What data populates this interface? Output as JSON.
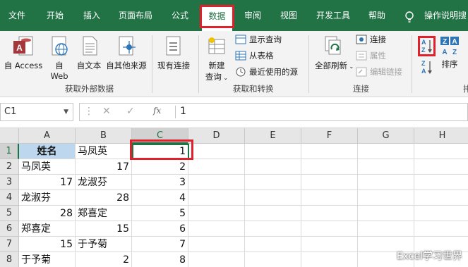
{
  "ribbon_tabs": [
    "文件",
    "开始",
    "插入",
    "页面布局",
    "公式",
    "数据",
    "审阅",
    "视图",
    "开发工具",
    "帮助",
    "操作说明搜"
  ],
  "active_tab": "数据",
  "ribbon": {
    "get_external": {
      "from_access": "自 Access",
      "from_web_line1": "自",
      "from_web_line2": "Web",
      "from_text": "自文本",
      "from_other": "自其他来源",
      "existing": "现有连接",
      "label": "获取外部数据"
    },
    "get_transform": {
      "new_query_line1": "新建",
      "new_query_line2": "查询",
      "show_queries": "显示查询",
      "from_table": "从表格",
      "recent_sources": "最近使用的源",
      "label": "获取和转换"
    },
    "connections": {
      "refresh_all": "全部刷新",
      "connections": "连接",
      "properties": "属性",
      "edit_links": "编辑链接",
      "label": "连接"
    },
    "sort": {
      "sort": "排序",
      "label_partial": "排"
    }
  },
  "formula_bar": {
    "name_box": "C1",
    "cancel_glyph": "✕",
    "enter_glyph": "✓",
    "fx": "fx",
    "value": "1"
  },
  "sheet": {
    "columns": [
      "A",
      "B",
      "C",
      "D",
      "E",
      "F",
      "G",
      "H"
    ],
    "rows": [
      "1",
      "2",
      "3",
      "4",
      "5",
      "6",
      "7",
      "8"
    ],
    "cells": {
      "A1": "姓名",
      "B1": "马凤英",
      "C1": "1",
      "A2": "马凤英",
      "B2": "17",
      "C2": "2",
      "A3": "17",
      "B3": "龙淑芬",
      "C3": "3",
      "A4": "龙淑芬",
      "B4": "28",
      "C4": "4",
      "A5": "28",
      "B5": "郑喜定",
      "C5": "5",
      "A6": "郑喜定",
      "B6": "15",
      "C6": "6",
      "A7": "15",
      "B7": "于予菊",
      "C7": "7",
      "A8": "于予菊",
      "B8": "2",
      "C8": "8"
    }
  },
  "watermark": "Excel学习世界",
  "colors": {
    "excel_green": "#217346",
    "highlight_red": "#e0202a",
    "header_fill": "#bdd7ee"
  }
}
